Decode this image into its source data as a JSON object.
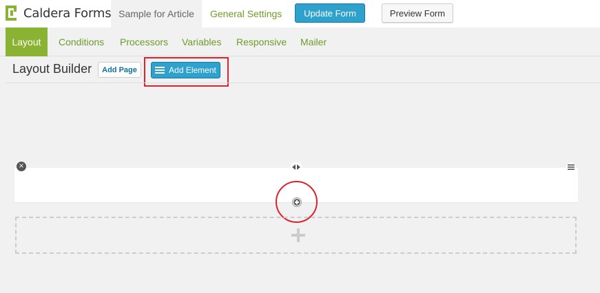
{
  "brand": {
    "name": "Caldera Forms",
    "logo_color": "#8bb333"
  },
  "topbar": {
    "form_name_tab": "Sample for Article",
    "general_settings": "General Settings",
    "update_button": "Update Form",
    "preview_button": "Preview Form"
  },
  "tabs": [
    {
      "label": "Layout",
      "active": true
    },
    {
      "label": "Conditions",
      "active": false
    },
    {
      "label": "Processors",
      "active": false
    },
    {
      "label": "Variables",
      "active": false
    },
    {
      "label": "Responsive",
      "active": false
    },
    {
      "label": "Mailer",
      "active": false
    }
  ],
  "builder": {
    "title": "Layout Builder",
    "add_page": "Add Page",
    "add_element": "Add Element"
  },
  "colors": {
    "accent_green": "#8bb333",
    "link_green": "#6e9b2a",
    "primary_blue": "#2ea2cc",
    "annotation_red": "#e0202a"
  },
  "icons": {
    "row_remove": "close-icon",
    "row_resize": "resize-icon",
    "row_menu": "menu-icon",
    "column_add": "add-circle-icon",
    "new_row": "plus-icon"
  }
}
